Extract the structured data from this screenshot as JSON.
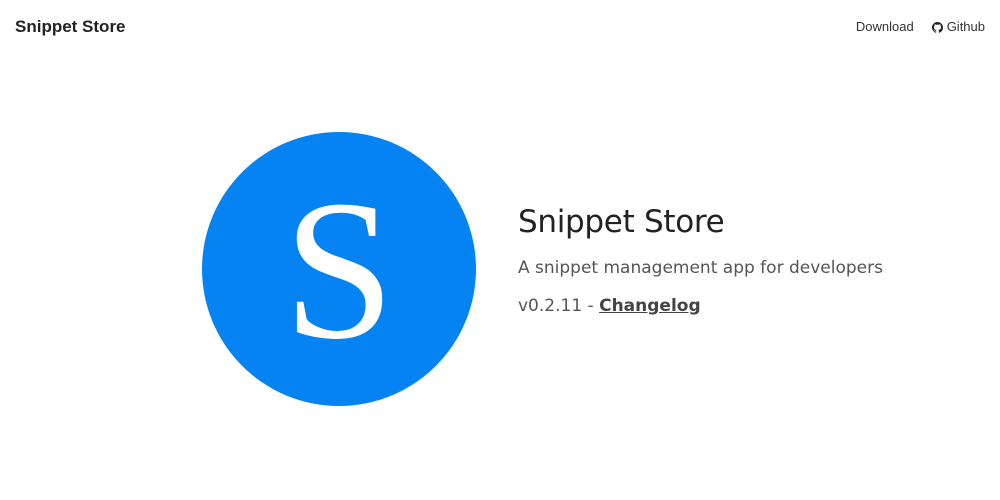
{
  "navbar": {
    "brand": "Snippet Store",
    "links": {
      "download": "Download",
      "github": "Github"
    },
    "github_icon": "github-icon"
  },
  "hero": {
    "logo_letter": "S",
    "logo_color": "#0583f2",
    "title": "Snippet Store",
    "tagline": "A snippet management app for developers",
    "version": "v0.2.11",
    "separator": " - ",
    "changelog_label": "Changelog"
  }
}
